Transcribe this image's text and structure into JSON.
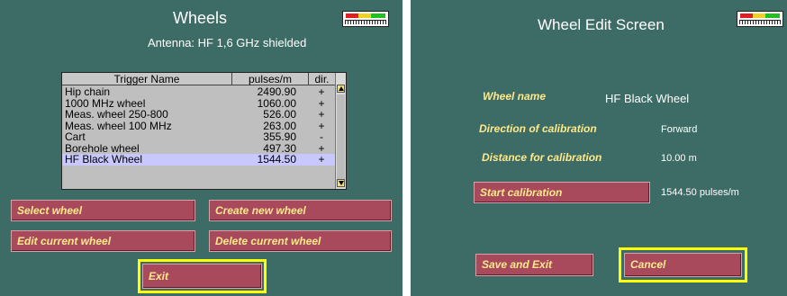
{
  "left": {
    "title": "Wheels",
    "antenna": "Antenna: HF 1,6 GHz shielded",
    "table": {
      "headers": [
        "Trigger Name",
        "pulses/m",
        "dir."
      ],
      "rows": [
        {
          "name": "Hip chain",
          "pulses": "2490.90",
          "dir": "+"
        },
        {
          "name": "1000 MHz wheel",
          "pulses": "1060.00",
          "dir": "+"
        },
        {
          "name": "Meas. wheel 250-800",
          "pulses": "526.00",
          "dir": "+"
        },
        {
          "name": "Meas. wheel 100 MHz",
          "pulses": "263.00",
          "dir": "+"
        },
        {
          "name": "Cart",
          "pulses": "355.90",
          "dir": "-"
        },
        {
          "name": "Borehole wheel",
          "pulses": "497.30",
          "dir": "+"
        },
        {
          "name": "HF Black Wheel",
          "pulses": "1544.50",
          "dir": "+"
        }
      ]
    },
    "buttons": {
      "select": "Select wheel",
      "create": "Create new wheel",
      "edit": "Edit current wheel",
      "delete": "Delete current wheel",
      "exit": "Exit"
    }
  },
  "right": {
    "title": "Wheel Edit Screen",
    "wheel_name_label": "Wheel name",
    "wheel_name_value": "HF Black Wheel",
    "direction_label": "Direction of calibration",
    "direction_value": "Forward",
    "distance_label": "Distance for calibration",
    "distance_value": "10.00 m",
    "start_label": "Start calibration",
    "start_value": "1544.50 pulses/m",
    "save_label": "Save and Exit",
    "cancel_label": "Cancel"
  },
  "colors": {
    "background": "#3d6b65",
    "button": "#a84a5c",
    "button_text": "#ffe98a",
    "highlight": "#ffff00",
    "selected_row": "#c8c8ff"
  },
  "icons": [
    "signal-meter-icon",
    "scroll-up-icon",
    "scroll-down-icon"
  ]
}
